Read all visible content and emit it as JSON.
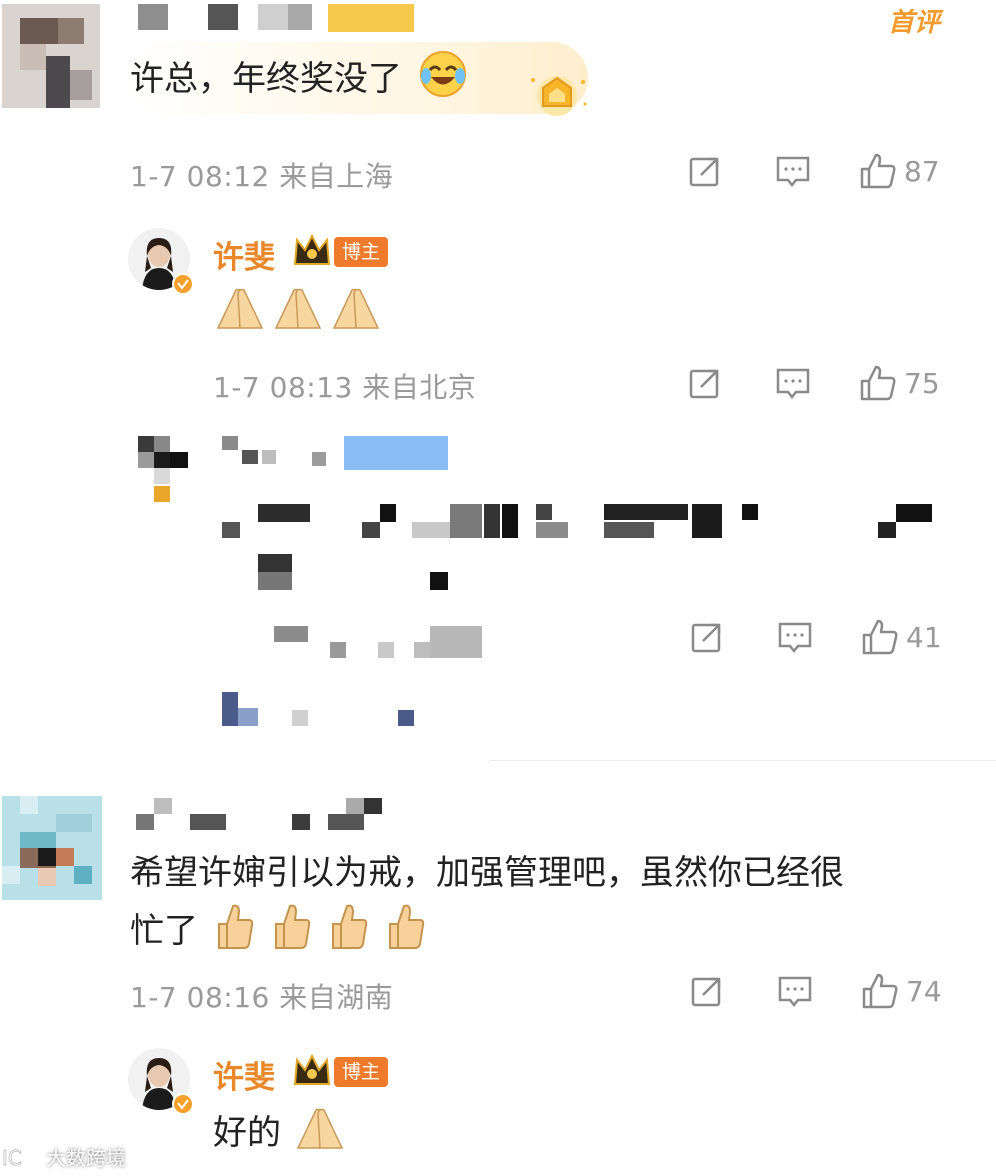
{
  "comment1": {
    "first_tag": "首评",
    "text": "许总，年终奖没了",
    "meta": "1-7 08:12 来自上海",
    "likes": "87"
  },
  "reply1": {
    "name": "许斐",
    "badge": "博主",
    "meta": "1-7 08:13 来自北京",
    "likes": "75"
  },
  "reply2": {
    "likes": "41"
  },
  "comment2": {
    "text_line1": "希望许婶引以为戒，加强管理吧，虽然你已经很",
    "text_line2": "忙了",
    "meta": "1-7 08:16 来自湖南",
    "likes": "74"
  },
  "reply3": {
    "name": "许斐",
    "badge": "博主",
    "text": "好的"
  },
  "watermark": "大数跨境",
  "colors": {
    "accent_orange": "#e8882a",
    "meta_gray": "#9a9a9a",
    "badge_orange": "#f07a2b"
  }
}
